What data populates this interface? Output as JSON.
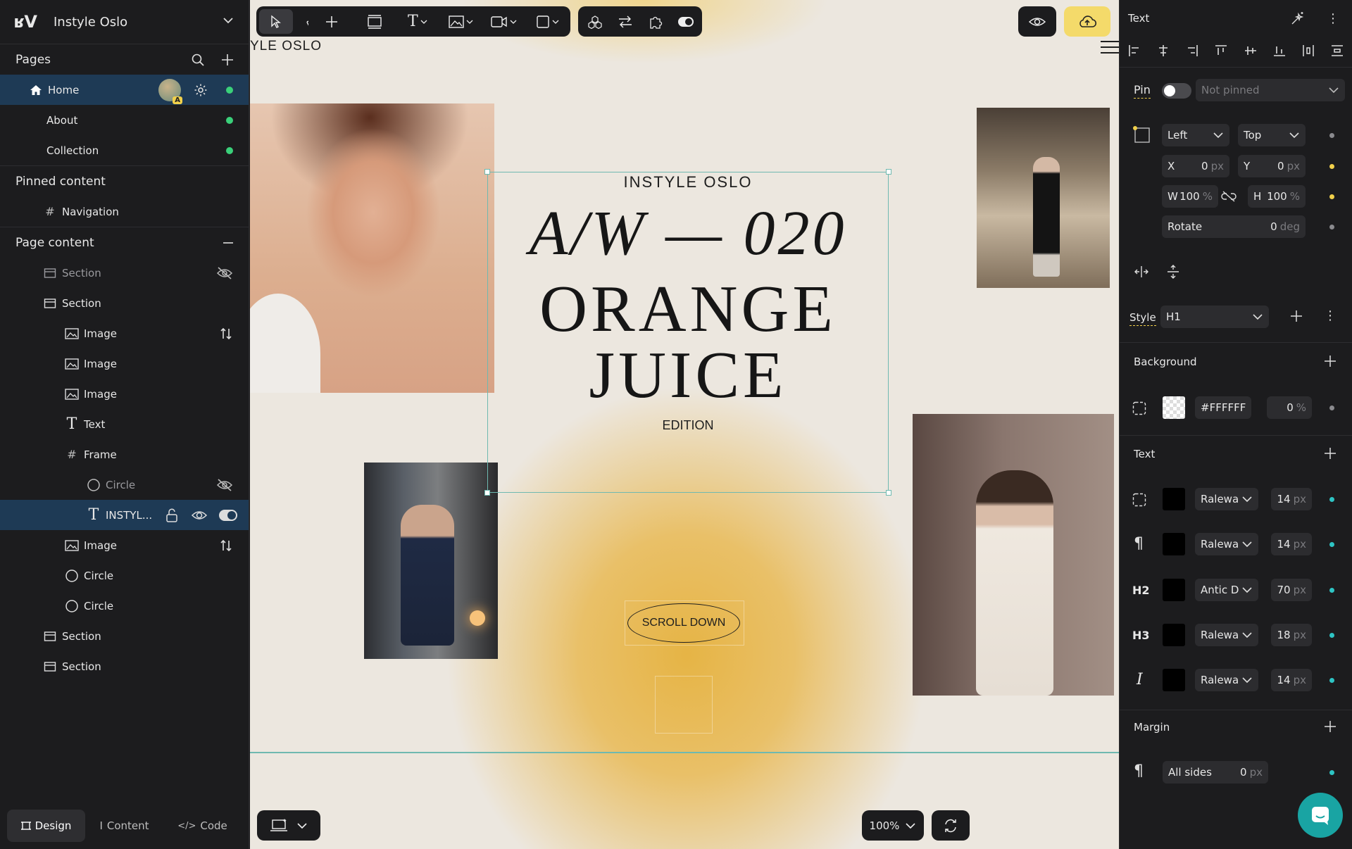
{
  "site": {
    "logo": "ʁV",
    "name": "Instyle Oslo"
  },
  "pages": {
    "title": "Pages",
    "items": [
      {
        "label": "Home",
        "avatar_badge": "A"
      },
      {
        "label": "About"
      },
      {
        "label": "Collection"
      }
    ]
  },
  "pinned": {
    "title": "Pinned content",
    "items": [
      {
        "label": "Navigation"
      }
    ]
  },
  "page_content": {
    "title": "Page content",
    "items": [
      {
        "label": "Section"
      },
      {
        "label": "Section"
      },
      {
        "label": "Image"
      },
      {
        "label": "Image"
      },
      {
        "label": "Image"
      },
      {
        "label": "Text"
      },
      {
        "label": "Frame"
      },
      {
        "label": "Circle"
      },
      {
        "label": "INSTYL..."
      },
      {
        "label": "Image"
      },
      {
        "label": "Circle"
      },
      {
        "label": "Circle"
      },
      {
        "label": "Section"
      },
      {
        "label": "Section"
      }
    ]
  },
  "bottom_tabs": {
    "design": "Design",
    "content": "Content",
    "code": "Code"
  },
  "canvas": {
    "brand_partial": "YLE OSLO",
    "hero_small": "INSTYLE OSLO",
    "hero_aw": "A/W — 020",
    "hero_line1": "ORANGE",
    "hero_line2": "JUICE",
    "hero_edition": "EDITION",
    "scroll_label": "SCROLL DOWN",
    "zoom": "100%"
  },
  "inspector": {
    "title": "Text",
    "pin_label": "Pin",
    "pin_value": "Not pinned",
    "anchor_h": "Left",
    "anchor_v": "Top",
    "x_label": "X",
    "x_value": "0",
    "x_unit": "px",
    "y_label": "Y",
    "y_value": "0",
    "y_unit": "px",
    "w_label": "W",
    "w_value": "100",
    "w_unit": "%",
    "h_label": "H",
    "h_value": "100",
    "h_unit": "%",
    "rotate_label": "Rotate",
    "rotate_value": "0",
    "rotate_unit": "deg",
    "style_label": "Style",
    "style_value": "H1",
    "background_title": "Background",
    "bg_hex": "#FFFFFF",
    "bg_opacity": "0",
    "bg_opacity_unit": "%",
    "text_title": "Text",
    "text_rows": [
      {
        "tag": "",
        "font": "Ralewa",
        "size": "14",
        "unit": "px"
      },
      {
        "tag": "",
        "font": "Ralewa",
        "size": "14",
        "unit": "px"
      },
      {
        "tag": "H2",
        "font": "Antic D",
        "size": "70",
        "unit": "px"
      },
      {
        "tag": "H3",
        "font": "Ralewa",
        "size": "18",
        "unit": "px"
      },
      {
        "tag": "I",
        "font": "Ralewa",
        "size": "14",
        "unit": "px"
      }
    ],
    "margin_title": "Margin",
    "margin_label": "All sides",
    "margin_value": "0",
    "margin_unit": "px"
  },
  "colors": {
    "accent_teal": "#6fb9b0",
    "publish_yellow": "#f4da6a",
    "status_green": "#3ad07a",
    "selected_row": "#1e3a55",
    "chat_teal": "#19a4a3"
  }
}
